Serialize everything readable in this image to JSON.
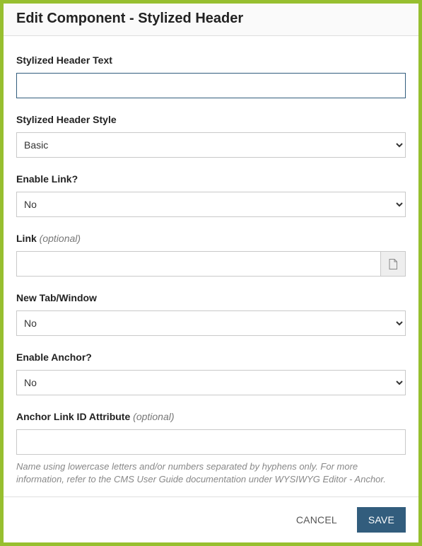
{
  "header": {
    "title": "Edit Component - Stylized Header"
  },
  "form": {
    "stylizedHeaderText": {
      "label": "Stylized Header Text",
      "value": ""
    },
    "stylizedHeaderStyle": {
      "label": "Stylized Header Style",
      "value": "Basic",
      "options": [
        "Basic"
      ]
    },
    "enableLink": {
      "label": "Enable Link?",
      "value": "No",
      "options": [
        "No"
      ]
    },
    "link": {
      "label": "Link",
      "optional": "(optional)",
      "value": ""
    },
    "newTabWindow": {
      "label": "New Tab/Window",
      "value": "No",
      "options": [
        "No"
      ]
    },
    "enableAnchor": {
      "label": "Enable Anchor?",
      "value": "No",
      "options": [
        "No"
      ]
    },
    "anchorLinkId": {
      "label": "Anchor Link ID Attribute",
      "optional": "(optional)",
      "value": "",
      "help": "Name using lowercase letters and/or numbers separated by hyphens only. For more information, refer to the CMS User Guide documentation under WYSIWYG Editor - Anchor."
    }
  },
  "footer": {
    "cancel": "CANCEL",
    "save": "SAVE"
  }
}
